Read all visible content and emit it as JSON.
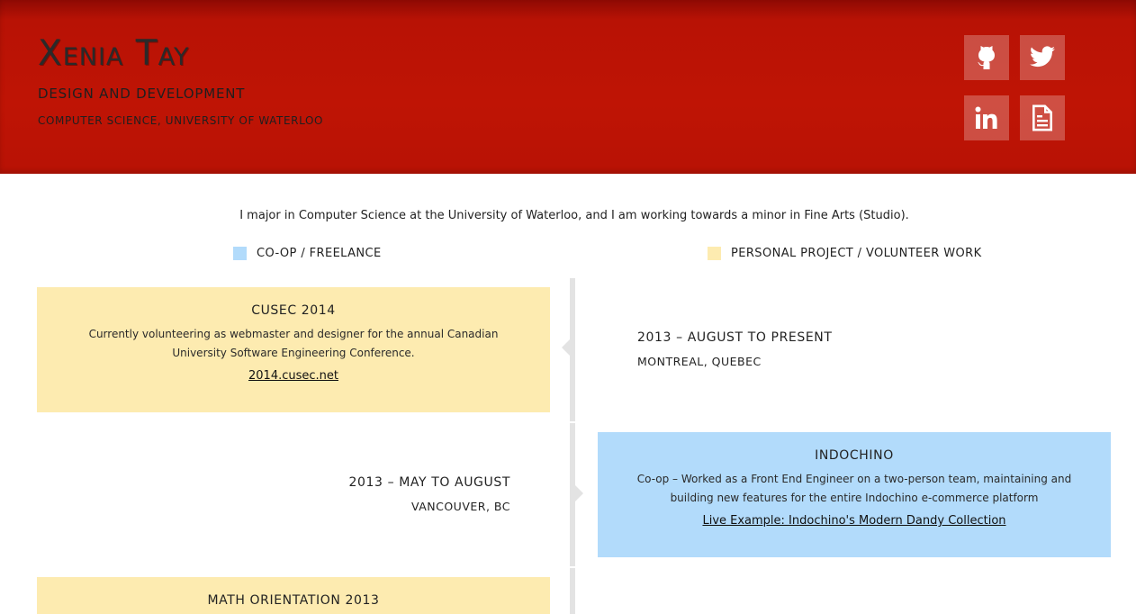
{
  "header": {
    "name": "Xenia Tay",
    "subtitle": "DESIGN AND DEVELOPMENT",
    "school": "COMPUTER SCIENCE, UNIVERSITY OF WATERLOO",
    "background_color": "#bf1405",
    "social": [
      {
        "icon": "github-icon"
      },
      {
        "icon": "twitter-icon"
      },
      {
        "icon": "linkedin-icon"
      },
      {
        "icon": "resume-icon"
      }
    ]
  },
  "intro": "I major in Computer Science at the University of Waterloo, and I am working towards a minor in Fine Arts (Studio).",
  "legend": {
    "coop": {
      "label": "CO-OP / FREELANCE",
      "color": "#b2dbfb"
    },
    "personal": {
      "label": "PERSONAL PROJECT / VOLUNTEER WORK",
      "color": "#fdebb0"
    }
  },
  "timeline": [
    {
      "title": "CUSEC 2014",
      "description": "Currently volunteering as webmaster and designer for the annual Canadian University Software Engineering Conference.",
      "link": "2014.cusec.net",
      "date": "2013 – AUGUST TO PRESENT",
      "place": "MONTREAL, QUEBEC",
      "type": "personal"
    },
    {
      "title": "INDOCHINO",
      "description": "Co-op – Worked as a Front End Engineer on a two-person team, maintaining and building new features for the entire Indochino e-commerce platform",
      "link": "Live Example: Indochino's Modern Dandy Collection",
      "date": "2013 – MAY TO AUGUST",
      "place": "VANCOUVER, BC",
      "type": "coop"
    },
    {
      "title": "MATH ORIENTATION 2013",
      "type": "personal"
    }
  ]
}
